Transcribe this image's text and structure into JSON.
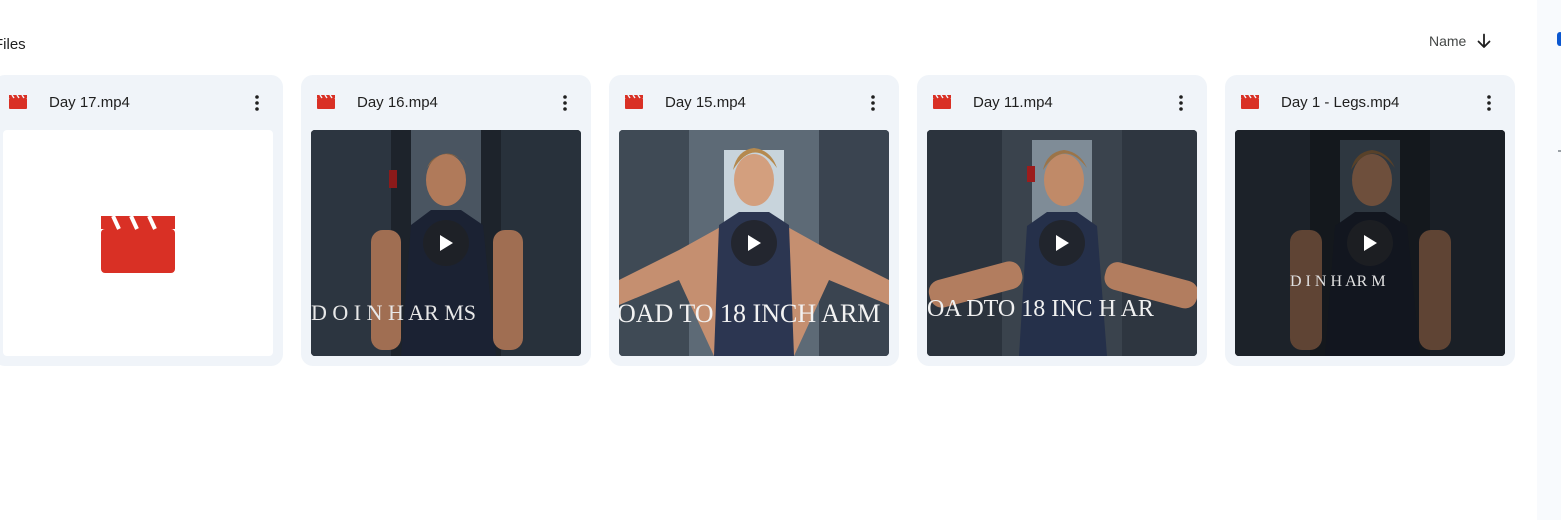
{
  "section": {
    "title": "Files"
  },
  "sort": {
    "label": "Name",
    "direction_icon": "arrow-down-icon"
  },
  "accent_color": "#0b57d0",
  "video_icon_color": "#d93025",
  "cards": [
    {
      "name": "Day 17.mp4",
      "thumbnail": "placeholder"
    },
    {
      "name": "Day 16.mp4",
      "thumbnail": "video"
    },
    {
      "name": "Day 15.mp4",
      "thumbnail": "video"
    },
    {
      "name": "Day 11.mp4",
      "thumbnail": "video"
    },
    {
      "name": "Day 1 - Legs.mp4",
      "thumbnail": "video"
    }
  ],
  "overlay_texts": [
    "D  O  I  N  H  AR  MS",
    "OAD TO 18 INCH ARM",
    "OA DTO 18 INC H AR",
    "D  I  N  H  AR  M"
  ]
}
